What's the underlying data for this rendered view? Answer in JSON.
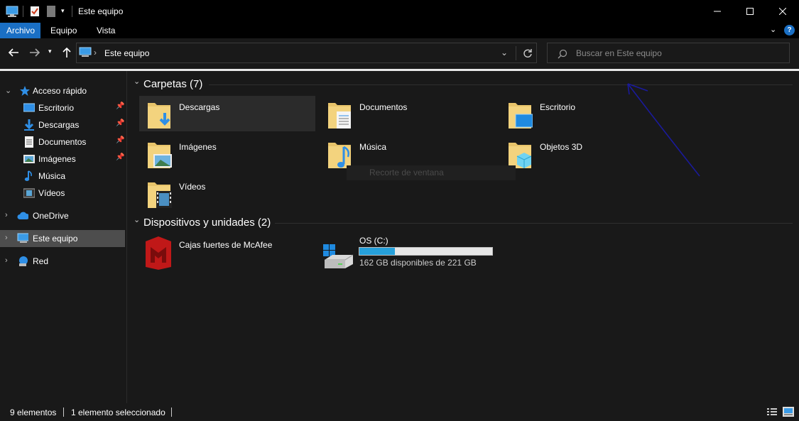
{
  "window": {
    "title": "Este equipo"
  },
  "ribbon": {
    "tabs": [
      {
        "label": "Archivo",
        "active": true
      },
      {
        "label": "Equipo",
        "active": false
      },
      {
        "label": "Vista",
        "active": false
      }
    ],
    "help_label": "?"
  },
  "address": {
    "path": "Este equipo",
    "separator": "›"
  },
  "search": {
    "placeholder": "Buscar en Este equipo"
  },
  "nav_pane": {
    "items": [
      {
        "label": "Acceso rápido",
        "icon": "star-icon"
      },
      {
        "label": "Escritorio",
        "icon": "desktop-icon",
        "pinned": true
      },
      {
        "label": "Descargas",
        "icon": "download-icon",
        "pinned": true
      },
      {
        "label": "Documentos",
        "icon": "document-icon",
        "pinned": true
      },
      {
        "label": "Imágenes",
        "icon": "image-icon",
        "pinned": true
      },
      {
        "label": "Música",
        "icon": "music-icon"
      },
      {
        "label": "Vídeos",
        "icon": "video-icon"
      },
      {
        "label": "OneDrive",
        "icon": "cloud-icon"
      },
      {
        "label": "Este equipo",
        "icon": "computer-icon",
        "selected": true
      },
      {
        "label": "Red",
        "icon": "network-icon"
      }
    ]
  },
  "content": {
    "folders_header": "Carpetas (7)",
    "folders": [
      {
        "label": "Descargas",
        "icon": "download-folder-icon"
      },
      {
        "label": "Documentos",
        "icon": "documents-folder-icon"
      },
      {
        "label": "Escritorio",
        "icon": "desktop-folder-icon"
      },
      {
        "label": "Imágenes",
        "icon": "pictures-folder-icon"
      },
      {
        "label": "Música",
        "icon": "music-folder-icon"
      },
      {
        "label": "Objetos 3D",
        "icon": "3d-objects-folder-icon"
      },
      {
        "label": "Vídeos",
        "icon": "videos-folder-icon"
      }
    ],
    "devices_header": "Dispositivos y unidades (2)",
    "devices": [
      {
        "label": "Cajas fuertes de McAfee",
        "icon": "mcafee-icon"
      },
      {
        "label": "OS (C:)",
        "icon": "drive-icon",
        "free_text": "162 GB disponibles de 221 GB",
        "used_fraction": 0.267
      }
    ],
    "tooltip": "Recorte de ventana"
  },
  "status": {
    "count": "9 elementos",
    "selection": "1 elemento seleccionado"
  },
  "colors": {
    "accent": "#1a6fc4",
    "folder": "#e8c46a",
    "drive_fill": "#26a0da",
    "annotation": "#1a1a9a"
  }
}
